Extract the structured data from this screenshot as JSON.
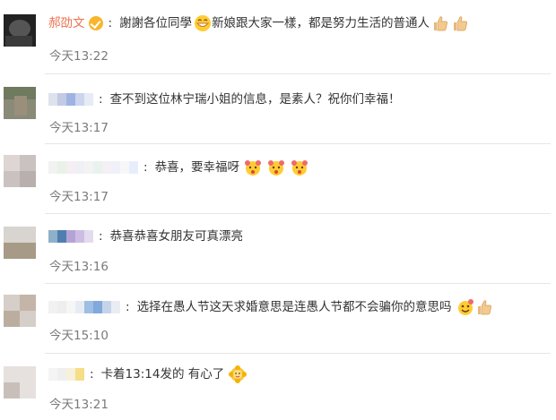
{
  "comments": [
    {
      "user": "郝劭文",
      "verified": true,
      "text": "謝謝各位同學",
      "text2": "新娘跟大家一樣，都是努力生活的普通人",
      "time": "今天13:22"
    },
    {
      "text": "查不到这位林宁瑞小姐的信息，是素人？祝你们幸福！",
      "time": "今天13:17"
    },
    {
      "text": "恭喜，要幸福呀",
      "time": "今天13:17"
    },
    {
      "text": "恭喜恭喜女朋友可真漂亮",
      "time": "今天13:16"
    },
    {
      "text": "选择在愚人节这天求婚意思是连愚人节都不会骗你的意思吗",
      "time": "今天15:10"
    },
    {
      "text": "卡着13:14发的 有心了",
      "time": "今天13:21"
    }
  ],
  "colors": {
    "name": "#eb7350",
    "time": "#7a7a7a",
    "text": "#333333",
    "verified": "#f8b62d"
  },
  "icons": [
    "verified-badge-icon",
    "grin-emoji-icon",
    "thumbs-up-icon",
    "kiss-face-emoji-icon",
    "sunflower-emoji-icon"
  ]
}
